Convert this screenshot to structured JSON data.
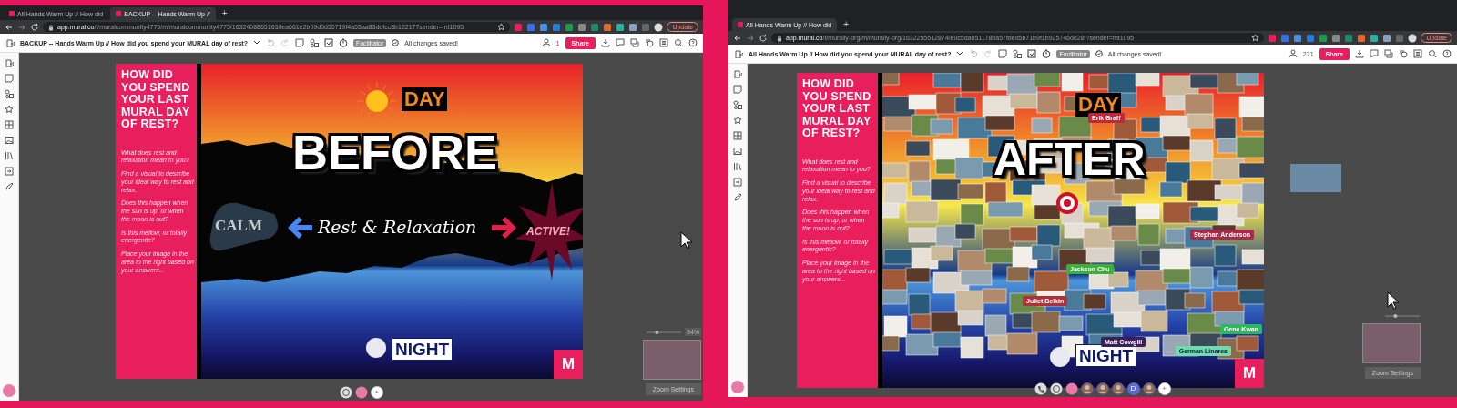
{
  "windows": [
    {
      "tabs": [
        {
          "title": "All Hands Warm Up // How did",
          "selected": false
        },
        {
          "title": "BACKUP -- Hands Warm Up //",
          "selected": true
        }
      ],
      "new_tab": "+",
      "url": {
        "host": "app.mural.co",
        "path": "/t/muralcommunity4775/m/muralcommunity4775/1632408865163/fea661e2b09d0d55719f4a53aa83ddfcc8b122177sender=mt1095"
      },
      "update_button": "Update",
      "mural_title": "BACKUP -- Hands Warm Up // How did you spend your MURAL day of rest?",
      "facilitator": "Facilitator",
      "save_status": "All changes saved!",
      "participants": "1",
      "share": "Share",
      "board": {
        "kind": "template",
        "panel_title": "HOW DID YOU SPEND YOUR LAST MURAL DAY OF REST?",
        "questions": [
          "What does rest and relaxation mean to you?",
          "Find a visual to describe your ideal way to rest and relax.",
          "Does this happen when the sun is up, or when the moon is out?",
          "Is this mellow, or totally energentic?",
          "Place your image in the area to the right based on your answers..."
        ],
        "day": "DAY",
        "heading": "BEFORE",
        "calm": "CALM",
        "theme": "Rest & Relaxation",
        "active": "ACTIVE!",
        "night": "NIGHT",
        "logo": "M"
      },
      "bottom_bar": [
        {
          "kind": "emoji"
        },
        {
          "kind": "self"
        },
        {
          "kind": "add",
          "text": "+"
        }
      ],
      "zoom": {
        "level": 0.3,
        "percent": "94%",
        "settings": "Zoom Settings"
      }
    },
    {
      "tabs": [
        {
          "title": "All Hands Warm Up // How did",
          "selected": true
        }
      ],
      "new_tab": "+",
      "url": {
        "host": "app.mural.co",
        "path": "/t/murally-org/m/murally-org/1632255512874/e0c5da051178ba57fded5b71b9f1b925746de28f?sender=mt1095"
      },
      "update_button": "Update",
      "mural_title": "All Hands Warm Up // How did you spend your MURAL day of rest?",
      "facilitator": "Facilitator",
      "save_status": "All changes saved!",
      "participants": "221",
      "share": "Share",
      "board": {
        "kind": "collage",
        "panel_title": "HOW DID YOU SPEND YOUR LAST MURAL DAY OF REST?",
        "questions": [
          "What does rest and relaxation mean to you?",
          "Find a visual to describe your ideal way to rest and relax.",
          "Does this happen when the sun is up, or when the moon is out?",
          "Is this mellow, or totally energentic?",
          "Place your image in the area to the right based on your answers..."
        ],
        "day": "DAY",
        "heading": "AFTER",
        "night": "NIGHT",
        "logo": "M",
        "name_tags": [
          {
            "name": "Erik Braff",
            "color": "#c0283a"
          },
          {
            "name": "Stephan Anderson",
            "color": "#a82a48"
          },
          {
            "name": "Jackson Chu",
            "color": "#3fae3f"
          },
          {
            "name": "Juliet Belkin",
            "color": "#b0303a"
          },
          {
            "name": "Matt Cowgill",
            "color": "#3b1e5a"
          },
          {
            "name": "Gene Kwan",
            "color": "#2eb85c"
          },
          {
            "name": "German Linares",
            "color": "#6fdcb0"
          }
        ]
      },
      "bottom_bar": [
        {
          "kind": "call"
        },
        {
          "kind": "emoji"
        },
        {
          "kind": "self"
        },
        {
          "kind": "photo"
        },
        {
          "kind": "photo"
        },
        {
          "kind": "photo"
        },
        {
          "kind": "initial",
          "text": "D"
        },
        {
          "kind": "photo"
        },
        {
          "kind": "add",
          "text": "+"
        }
      ],
      "zoom": {
        "level": 0.3,
        "settings": "Zoom Settings"
      }
    }
  ]
}
